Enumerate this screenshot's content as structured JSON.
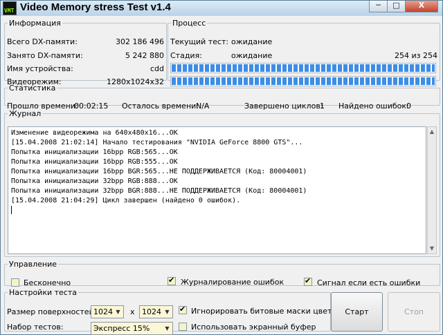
{
  "window": {
    "title": "Video Memory stress Test v1.4",
    "icon_text": "VMT",
    "buttons": {
      "minimize": "─",
      "maximize": "□",
      "close": "X"
    }
  },
  "info": {
    "legend": "Информация",
    "rows": [
      {
        "label": "Всего DX-памяти:",
        "value": "302 186 496"
      },
      {
        "label": "Занято DX-памяти:",
        "value": "5 242 880"
      },
      {
        "label": "Имя устройства:",
        "value": "cdd"
      },
      {
        "label": "Видеорежим:",
        "value": "1280x1024x32"
      }
    ]
  },
  "process": {
    "legend": "Процесс",
    "current_test_label": "Текущий тест:",
    "current_test_value": "ожидание",
    "stage_label": "Стадия:",
    "stage_value": "ожидание",
    "stage_counter": "254 из 254",
    "progress1": 1.0,
    "progress2": 1.0
  },
  "stats": {
    "legend": "Статистика",
    "elapsed_label": "Прошло времени:",
    "elapsed_value": "00:02:15",
    "remaining_label": "Осталось времени:",
    "remaining_value": "N/A",
    "cycles_label": "Завершено циклов:",
    "cycles_value": "1",
    "errors_label": "Найдено ошибок:",
    "errors_value": "0"
  },
  "journal": {
    "legend": "Журнал",
    "lines": [
      "Изменение видеорежима на 640x480x16...OK",
      "[15.04.2008 21:02:14] Начало тестирования \"NVIDIA GeForce 8800 GTS\"...",
      "Попытка инициализации 16bpp RGB:565...OK",
      "Попытка инициализации 16bpp RGB:555...OK",
      "Попытка инициализации 16bpp BGR:565...НЕ ПОДДЕРЖИВАЕТСЯ (Код: 80004001)",
      "Попытка инициализации 32bpp RGB:888...OK",
      "Попытка инициализации 32bpp BGR:888...НЕ ПОДДЕРЖИВАЕТСЯ (Код: 80004001)",
      "[15.04.2008 21:04:29] Цикл завершен (найдено 0 ошибок)."
    ]
  },
  "control": {
    "legend": "Управление",
    "endless": {
      "label": "Бесконечно",
      "checked": false
    },
    "log_errors": {
      "label": "Журналирование ошибок",
      "checked": true
    },
    "beep_on_error": {
      "label": "Сигнал если есть ошибки",
      "checked": true
    }
  },
  "settings": {
    "legend": "Настройки теста",
    "surface_size_label": "Размер поверхностей:",
    "width_value": "1024",
    "x_sep": "x",
    "height_value": "1024",
    "test_set_label": "Набор тестов:",
    "test_set_value": "Экспресс 15%",
    "ignore_masks": {
      "label": "Игнорировать битовые маски цветов",
      "checked": true
    },
    "screen_buffer": {
      "label": "Использовать экранный буфер",
      "checked": false
    }
  },
  "actions": {
    "start_label": "Старт",
    "stop_label": "Стоп"
  },
  "colors": {
    "progress": "#3d8ee6",
    "input_bg": "#fbf6d6",
    "close_button": "#c4432b"
  },
  "scroll_icons": {
    "up": "▲",
    "down": "▼"
  },
  "combo_icon": "▼",
  "check_mark": "✔"
}
